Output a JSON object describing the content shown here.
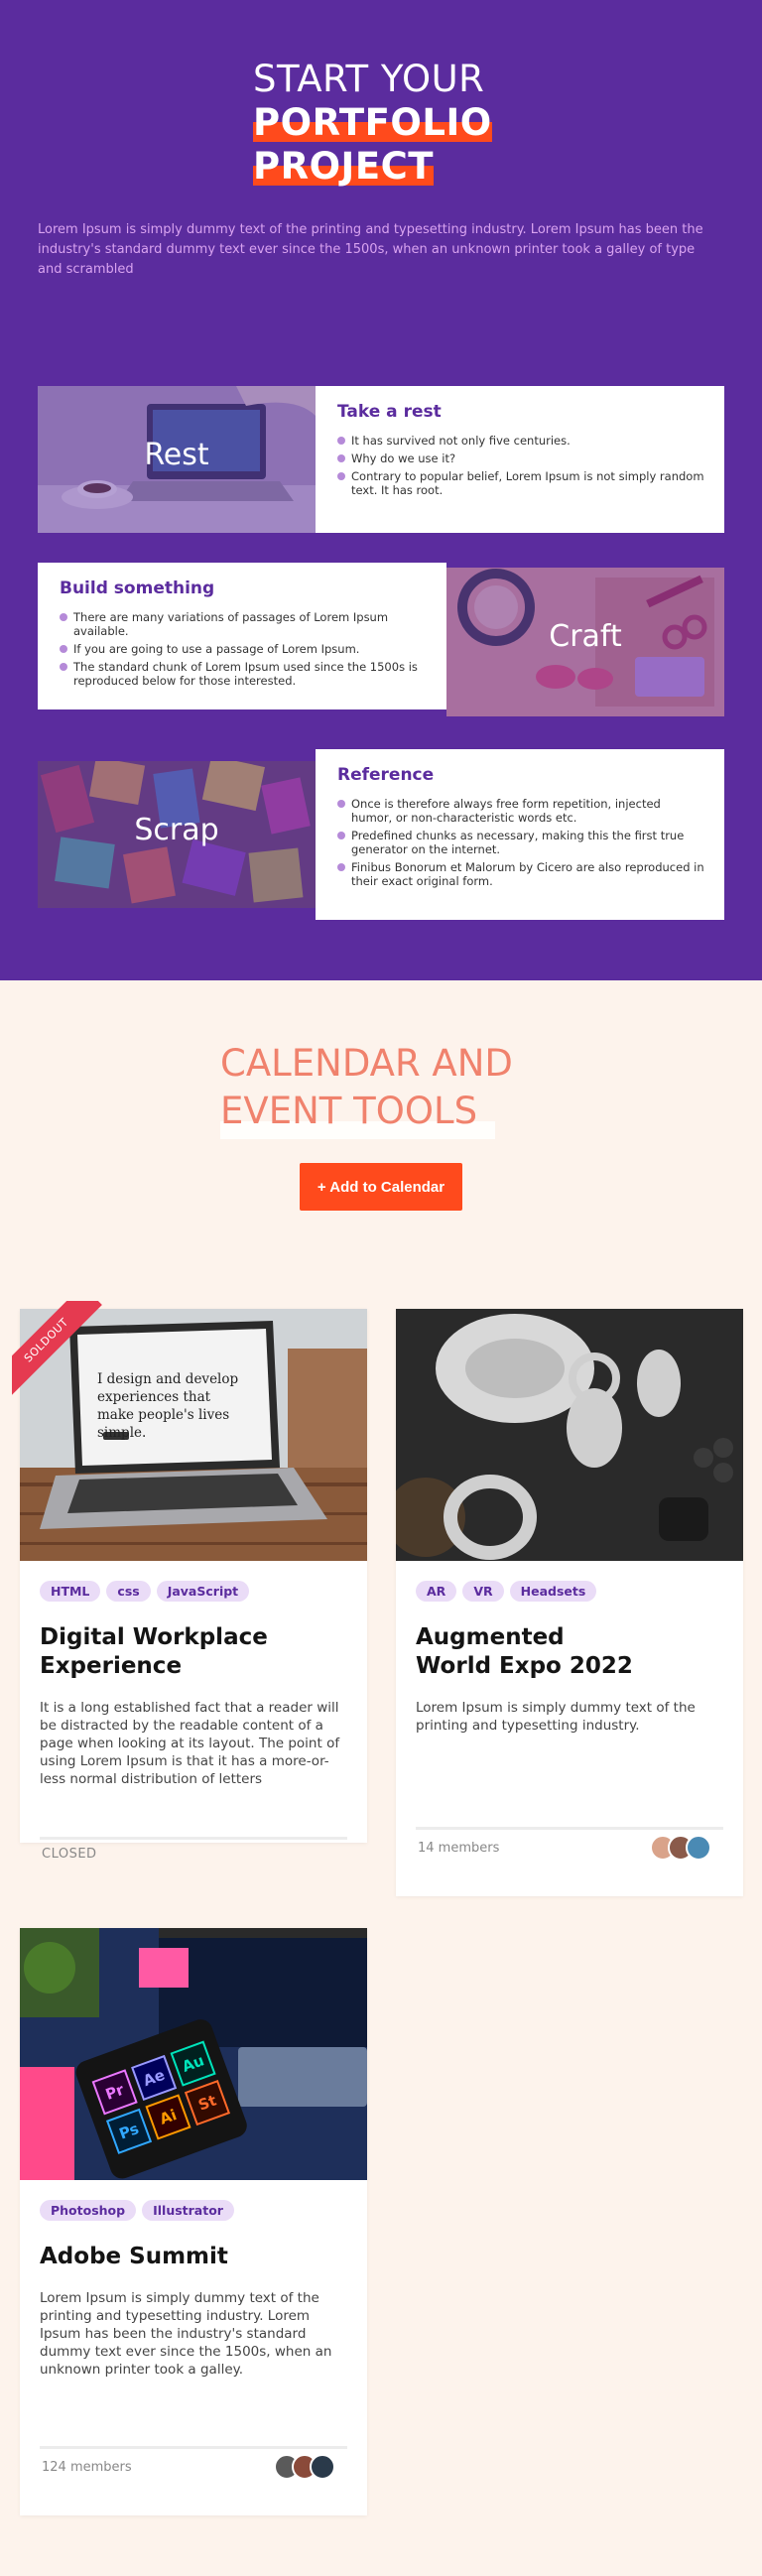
{
  "portfolio": {
    "title_line1": "START YOUR",
    "title_line2": "PORTFOLIO",
    "title_line3": "PROJECT",
    "text": "Lorem Ipsum is simply dummy text of the printing and typesetting industry. Lorem Ipsum has been the industry's standard dummy text ever since the 1500s, when an unknown printer took a galley of type and scrambled",
    "cards": [
      {
        "image_label": "Rest",
        "title": "Take a rest",
        "items": [
          "It has survived not only five centuries.",
          "Why do we use it?",
          "Contrary to popular belief, Lorem Ipsum is not simply random text. It has root."
        ]
      },
      {
        "image_label": "Craft",
        "title": "Build something",
        "items": [
          "There are many variations of passages of Lorem Ipsum available.",
          "If you are going to use a passage of Lorem Ipsum.",
          "The standard chunk of Lorem Ipsum used since the 1500s is reproduced below for those interested."
        ]
      },
      {
        "image_label": "Scrap",
        "title": "Reference",
        "items": [
          "Once is therefore always free form repetition, injected humor, or non-characteristic words etc.",
          "Predefined chunks as necessary, making this the first true generator on the internet.",
          "Finibus Bonorum et Malorum by Cicero are also reproduced in their exact original form."
        ]
      }
    ]
  },
  "calendar": {
    "title_line1": "CALENDAR AND",
    "title_line2": "EVENT TOOLS",
    "add_button": "+ Add to Calendar",
    "events": [
      {
        "ribbon": "SOLDOUT",
        "screen_text": "I design and develop experiences that make people's lives simple.",
        "tags": [
          "HTML",
          "css",
          "JavaScript"
        ],
        "title": "Digital Workplace Experience",
        "description": "It is a long established fact that a reader will be distracted by the readable content of a page when looking at its layout. The point of using Lorem Ipsum is that it has a more-or-less normal distribution of letters",
        "footer": "CLOSED"
      },
      {
        "tags": [
          "AR",
          "VR",
          "Headsets"
        ],
        "title": "Augmented World Expo 2022",
        "description": "Lorem Ipsum is simply dummy text of the printing and typesetting industry.",
        "footer": "14 members"
      },
      {
        "tags": [
          "Photoshop",
          "Illustrator"
        ],
        "title": "Adobe Summit",
        "description": "Lorem Ipsum is simply dummy text of the printing and typesetting industry. Lorem Ipsum has been the industry's standard dummy text ever since the 1500s, when an unknown printer took a galley.",
        "footer": "124 members",
        "app_icons": [
          "Pr",
          "Ae",
          "Au",
          "Ps",
          "Ai",
          "St"
        ]
      }
    ]
  },
  "colors": {
    "purple": "#5b2c9e",
    "orange": "#ff4a1c",
    "salmon": "#f0826d",
    "cream": "#fdf3ec"
  }
}
